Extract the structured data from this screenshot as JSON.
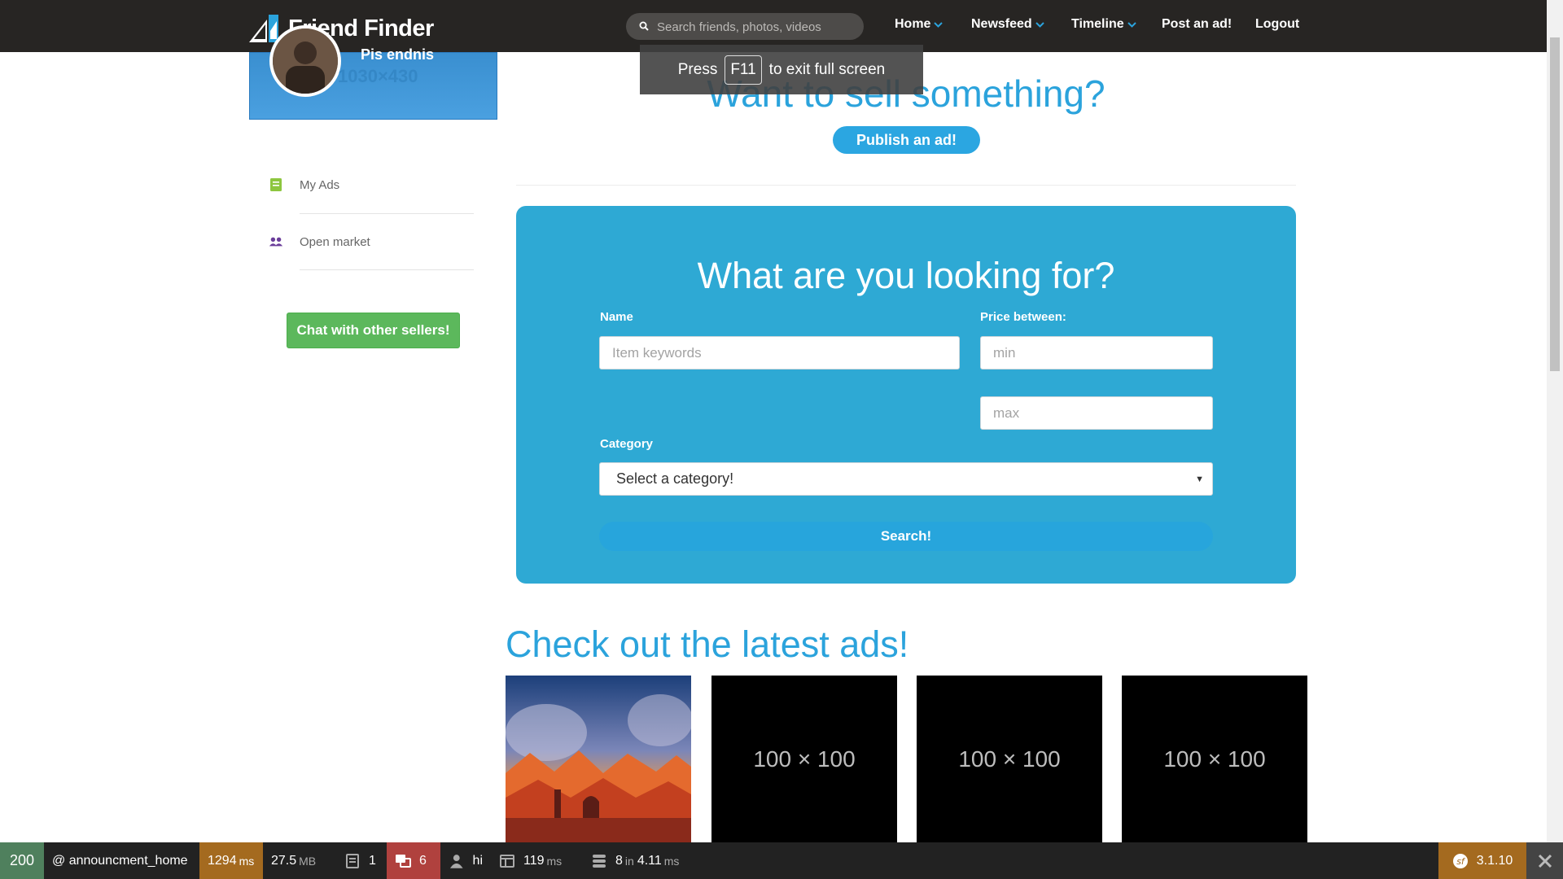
{
  "navbar": {
    "brand": "Friend Finder",
    "search_placeholder": "Search friends, photos, videos",
    "items": [
      {
        "label": "Home",
        "has_dropdown": true
      },
      {
        "label": "Newsfeed",
        "has_dropdown": true
      },
      {
        "label": "Timeline",
        "has_dropdown": true
      },
      {
        "label": "Post an ad!",
        "has_dropdown": false
      },
      {
        "label": "Logout",
        "has_dropdown": false
      }
    ]
  },
  "fullscreen_tip": {
    "press": "Press",
    "key": "F11",
    "rest": "to exit full screen"
  },
  "profile": {
    "name": "Pis endnis",
    "placeholder_text": "1030×430"
  },
  "sidebar": {
    "items": [
      {
        "label": "My Ads",
        "icon": "notebook-icon",
        "color": "#8dc63f"
      },
      {
        "label": "Open market",
        "icon": "users-icon",
        "color": "#6a3d9a"
      }
    ],
    "chat_button": "Chat with other sellers!"
  },
  "sell": {
    "title": "Want to sell something?",
    "publish_button": "Publish an ad!"
  },
  "search_panel": {
    "title": "What are you looking for?",
    "name_label": "Name",
    "name_placeholder": "Item keywords",
    "price_label": "Price between:",
    "min_placeholder": "min",
    "max_placeholder": "max",
    "category_label": "Category",
    "category_selected": "Select a category!",
    "search_button": "Search!"
  },
  "latest": {
    "title": "Check out the latest ads!",
    "ads": [
      {
        "kind": "image",
        "label": ""
      },
      {
        "kind": "placeholder",
        "label": "100 × 100"
      },
      {
        "kind": "placeholder",
        "label": "100 × 100"
      },
      {
        "kind": "placeholder",
        "label": "100 × 100"
      }
    ]
  },
  "debug_toolbar": {
    "status": "200",
    "route": "@ announcment_home",
    "time": "1294",
    "time_unit": "ms",
    "memory": "27.5",
    "memory_unit": "MB",
    "logs": "1",
    "translations": "6",
    "user": "hi",
    "twig_time": "119",
    "twig_unit": "ms",
    "db_queries": "8",
    "db_in": "in",
    "db_time": "4.11",
    "db_unit": "ms",
    "version": "3.1.10"
  },
  "colors": {
    "accent": "#2ba3dc",
    "panel": "#2ea9d4",
    "success": "#5cb85c",
    "navbar": "#272523"
  }
}
